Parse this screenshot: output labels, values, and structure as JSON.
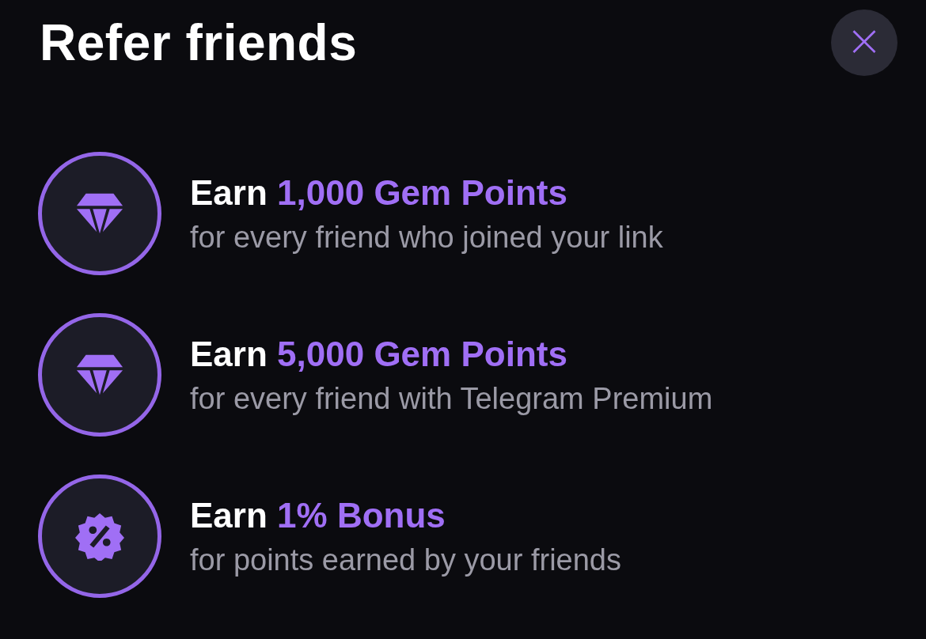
{
  "title": "Refer friends",
  "close": {
    "label": "×"
  },
  "rewards": [
    {
      "kind": "gem",
      "lead": "Earn",
      "highlight": "1,000 Gem Points",
      "subtitle": "for every friend who joined your link"
    },
    {
      "kind": "gem",
      "lead": "Earn",
      "highlight": "5,000 Gem Points",
      "subtitle": "for every friend with Telegram Premium"
    },
    {
      "kind": "percent",
      "lead": "Earn",
      "highlight": "1% Bonus",
      "subtitle": "for points earned by your friends"
    }
  ]
}
